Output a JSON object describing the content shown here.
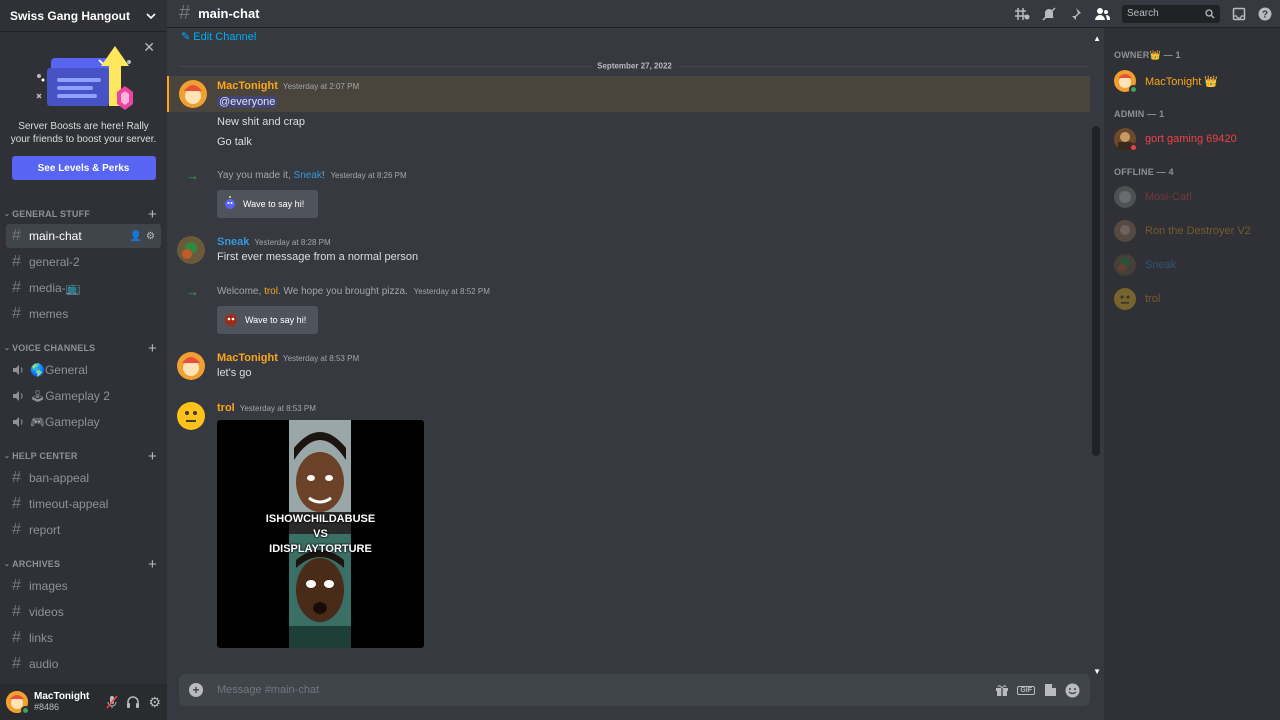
{
  "server": {
    "name": "Swiss Gang Hangout"
  },
  "boost": {
    "text": "Server Boosts are here! Rally your friends to boost your server.",
    "button": "See Levels & Perks"
  },
  "categories": [
    {
      "name": "GENERAL STUFF",
      "channels": [
        "main-chat",
        "general-2",
        "media-📺",
        "memes"
      ]
    },
    {
      "name": "VOICE CHANNELS",
      "channels": [
        "🌎General",
        "🕹Gameplay 2",
        "🎮Gameplay"
      ]
    },
    {
      "name": "HELP CENTER",
      "channels": [
        "ban-appeal",
        "timeout-appeal",
        "report"
      ]
    },
    {
      "name": "ARCHIVES",
      "channels": [
        "images",
        "videos",
        "links",
        "audio"
      ]
    }
  ],
  "user": {
    "name": "MacTonight",
    "tag": "#8486"
  },
  "topbar": {
    "channel": "main-chat",
    "search": "Search"
  },
  "chat": {
    "edit_channel": "Edit Channel",
    "date_divider": "September 27, 2022",
    "messages": [
      {
        "author": "MacTonight",
        "time": "Yesterday at 2:07 PM",
        "mention": "@everyone",
        "lines": [
          "New shit and crap",
          "Go talk"
        ]
      },
      {
        "system_pre": "Yay you made it, ",
        "system_name": "Sneak",
        "system_post": "!",
        "time": "Yesterday at 8:26 PM",
        "wave": "Wave to say hi!"
      },
      {
        "author": "Sneak",
        "time": "Yesterday at 8:28 PM",
        "text": "First ever message from a normal person"
      },
      {
        "system_pre": "Welcome, ",
        "system_name": "trol",
        "system_post": ". We hope you brought pizza.",
        "time": "Yesterday at 8:52 PM",
        "wave": "Wave to say hi!"
      },
      {
        "author": "MacTonight",
        "time": "Yesterday at 8:53 PM",
        "text": "let's go"
      },
      {
        "author": "trol",
        "time": "Yesterday at 8:53 PM",
        "image_caption": [
          "ISHOWCHILDABUSE",
          "VS",
          "IDISPLAYTORTURE"
        ]
      }
    ],
    "composer_placeholder": "Message #main-chat"
  },
  "members": {
    "groups": [
      {
        "label": "OWNER👑 — 1",
        "members": [
          {
            "name": "MacTonight 👑",
            "color": "#faa61a"
          }
        ]
      },
      {
        "label": "ADMIN — 1",
        "members": [
          {
            "name": "gort gaming 69420",
            "color": "#ed4245"
          }
        ]
      },
      {
        "label": "OFFLINE — 4",
        "members": [
          {
            "name": "Mosi-Cat!",
            "color": "#ed4245"
          },
          {
            "name": "Ron the Destroyer V2",
            "color": "#faa61a"
          },
          {
            "name": "Sneak",
            "color": "#3498db"
          },
          {
            "name": "trol",
            "color": "#faa61a"
          }
        ]
      }
    ]
  },
  "colors": {
    "accent": "#5865f2",
    "owner": "#faa61a",
    "admin": "#ed4245",
    "sneak": "#3498db",
    "online": "#3ba55d"
  }
}
